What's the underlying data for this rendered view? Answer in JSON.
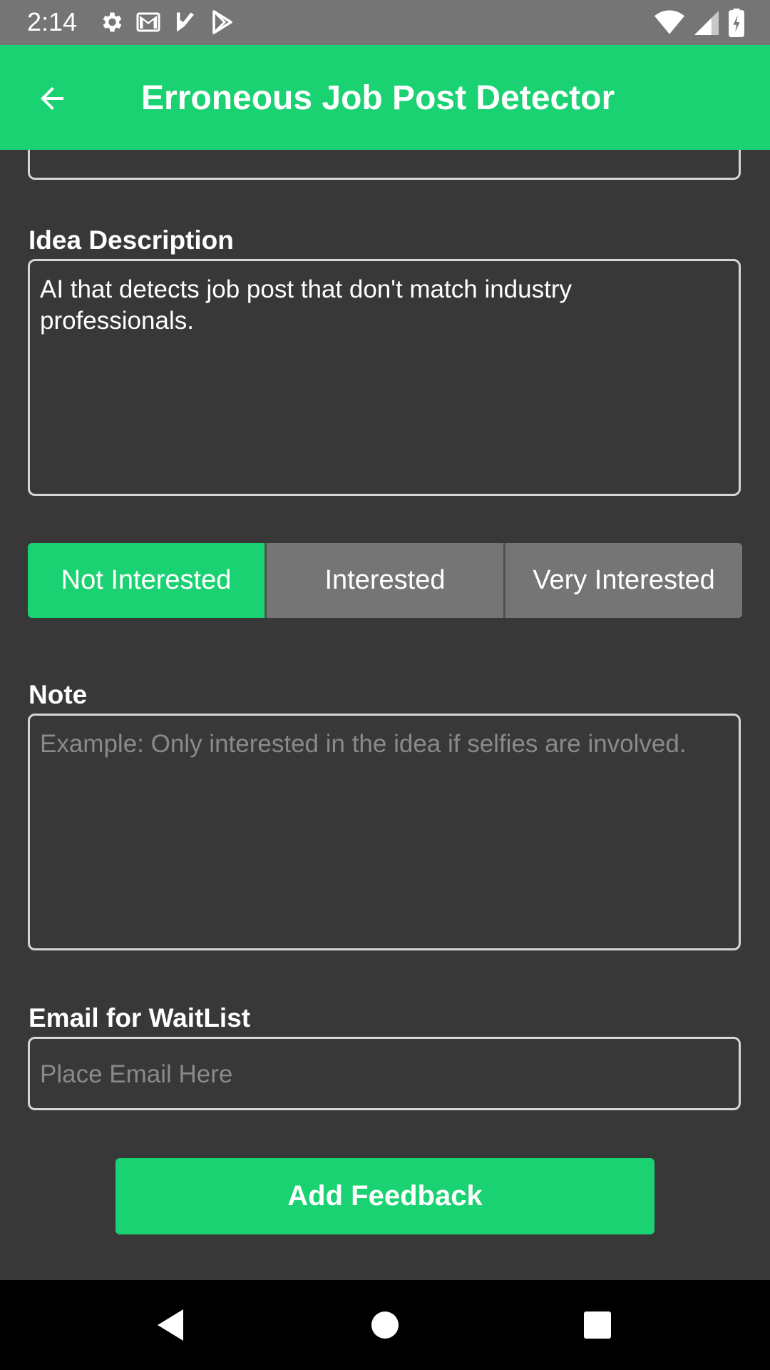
{
  "status_bar": {
    "time": "2:14",
    "left_icons": [
      "settings-icon",
      "gmail-icon",
      "check-flag-icon",
      "play-store-icon"
    ],
    "right_icons": [
      "wifi-icon",
      "signal-icon",
      "battery-charging-icon"
    ]
  },
  "app_bar": {
    "title": "Erroneous Job Post Detector",
    "back_icon": "arrow-back-icon"
  },
  "form": {
    "idea_description": {
      "label": "Idea Description",
      "value": "AI that detects job post that don't match industry professionals."
    },
    "interest": {
      "options": [
        "Not Interested",
        "Interested",
        "Very Interested"
      ],
      "selected": "Not Interested"
    },
    "note": {
      "label": "Note",
      "placeholder": "Example: Only interested in the idea if selfies are involved."
    },
    "email": {
      "label": "Email for WaitList",
      "placeholder": "Place Email Here"
    },
    "submit_label": "Add Feedback"
  },
  "colors": {
    "accent": "#1ad271",
    "background": "#383838",
    "status_bar": "#757575",
    "segment_inactive": "#757575",
    "nav_bar": "#000000"
  }
}
